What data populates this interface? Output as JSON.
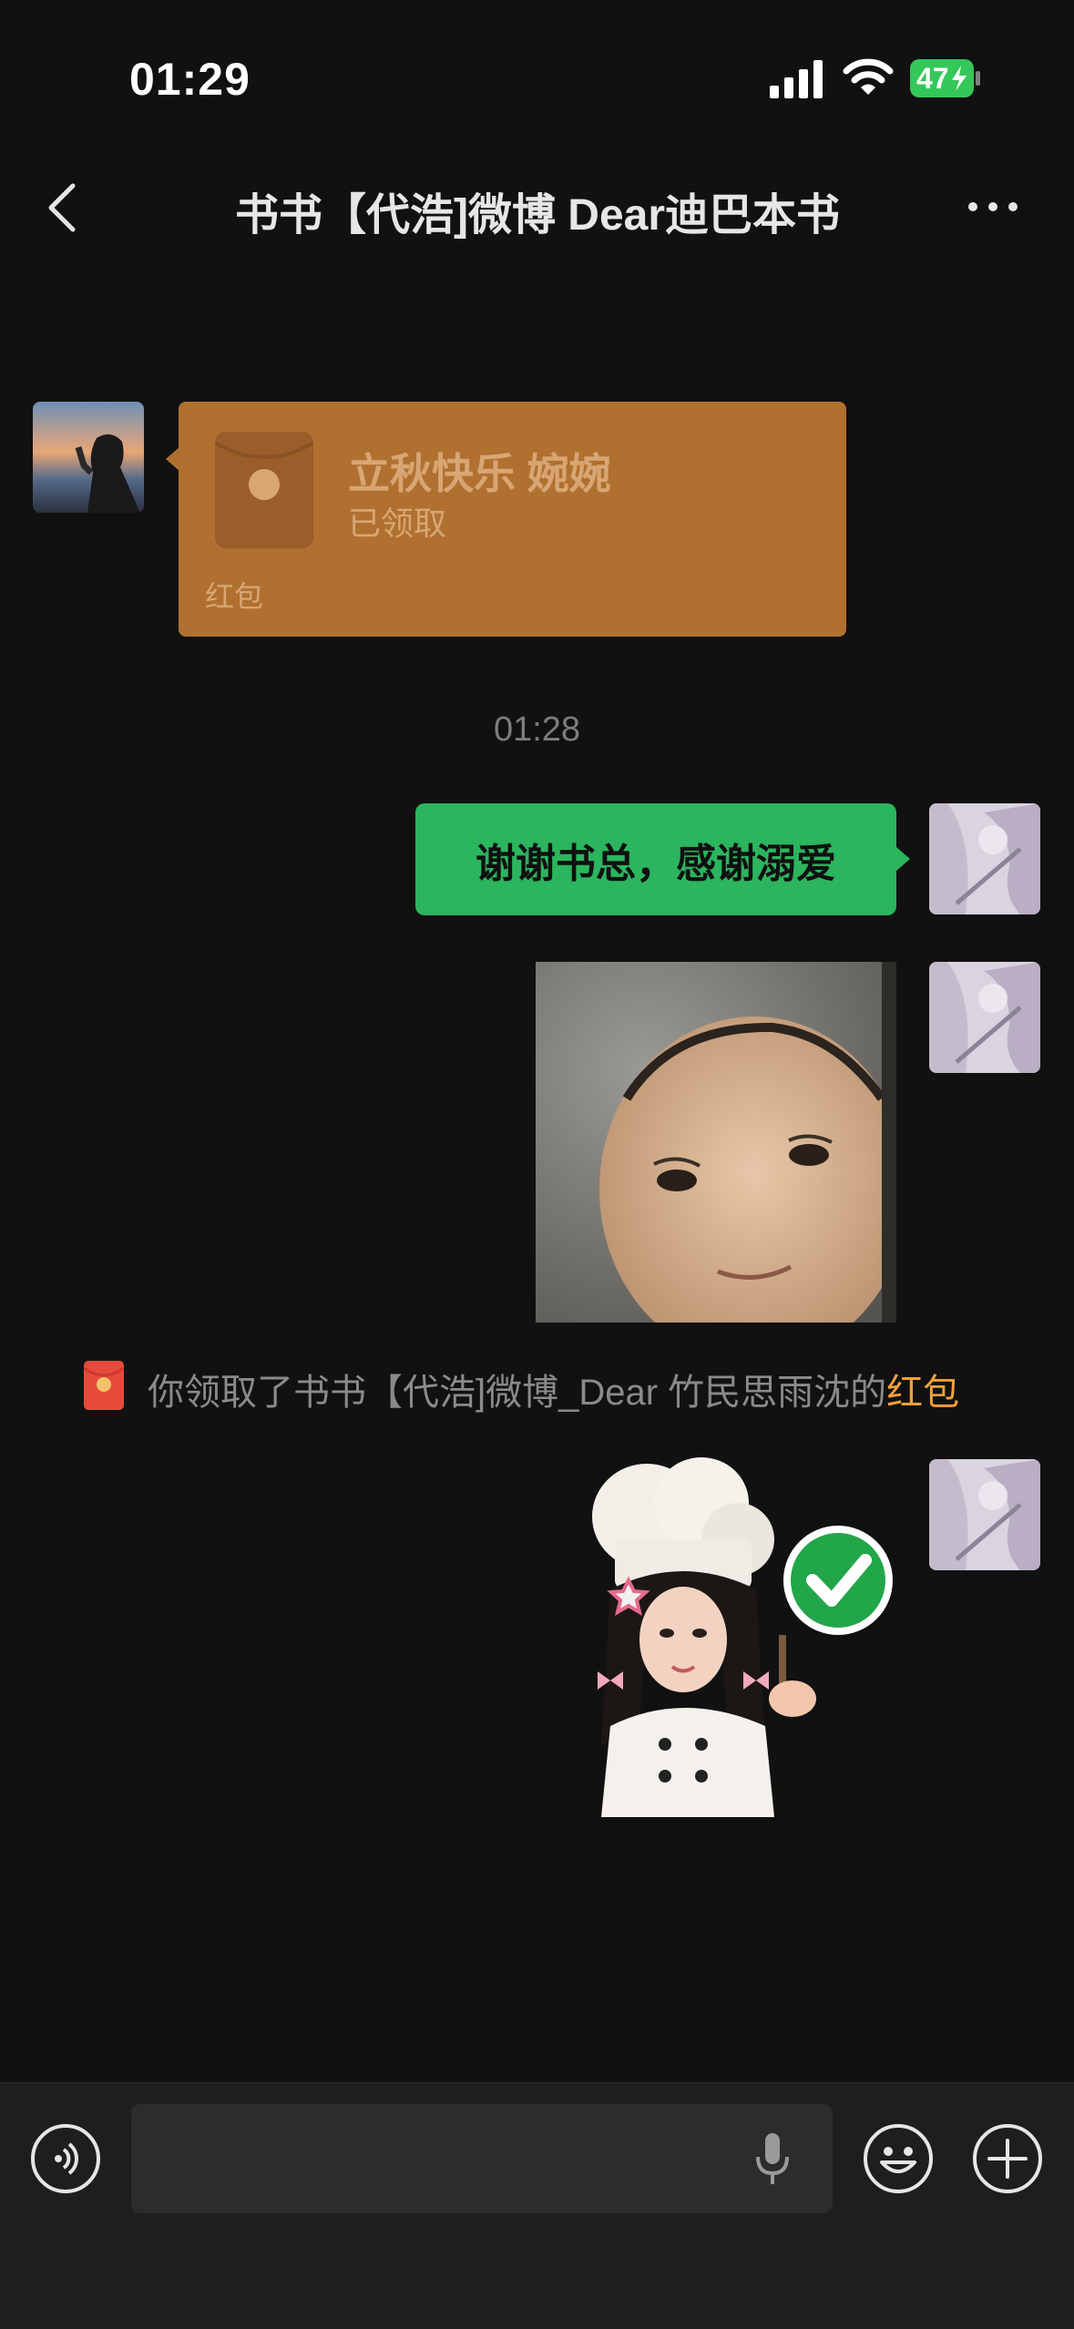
{
  "status_bar": {
    "time": "01:29",
    "battery": "47"
  },
  "nav": {
    "title": "书书【代浩]微博 Dear迪巴本书"
  },
  "messages": {
    "red_packet": {
      "title": "立秋快乐 婉婉",
      "status": "已领取",
      "label": "红包"
    },
    "timestamp": "01:28",
    "text_message": "谢谢书总，感谢溺爱",
    "system_notice": {
      "text": "你领取了书书【代浩]微博_Dear 竹民思雨沈的",
      "link": "红包"
    }
  },
  "icons": {
    "back": "chevron-left-icon",
    "more": "more-horizontal-icon",
    "voice": "voice-mode-icon",
    "mic": "microphone-icon",
    "emoji": "emoji-icon",
    "add": "plus-icon",
    "red_packet": "red-packet-icon"
  },
  "colors": {
    "background": "#111111",
    "red_packet": "#b07030",
    "bubble_green": "#2bb55e",
    "link": "#f2a03a",
    "battery": "#34c759"
  }
}
